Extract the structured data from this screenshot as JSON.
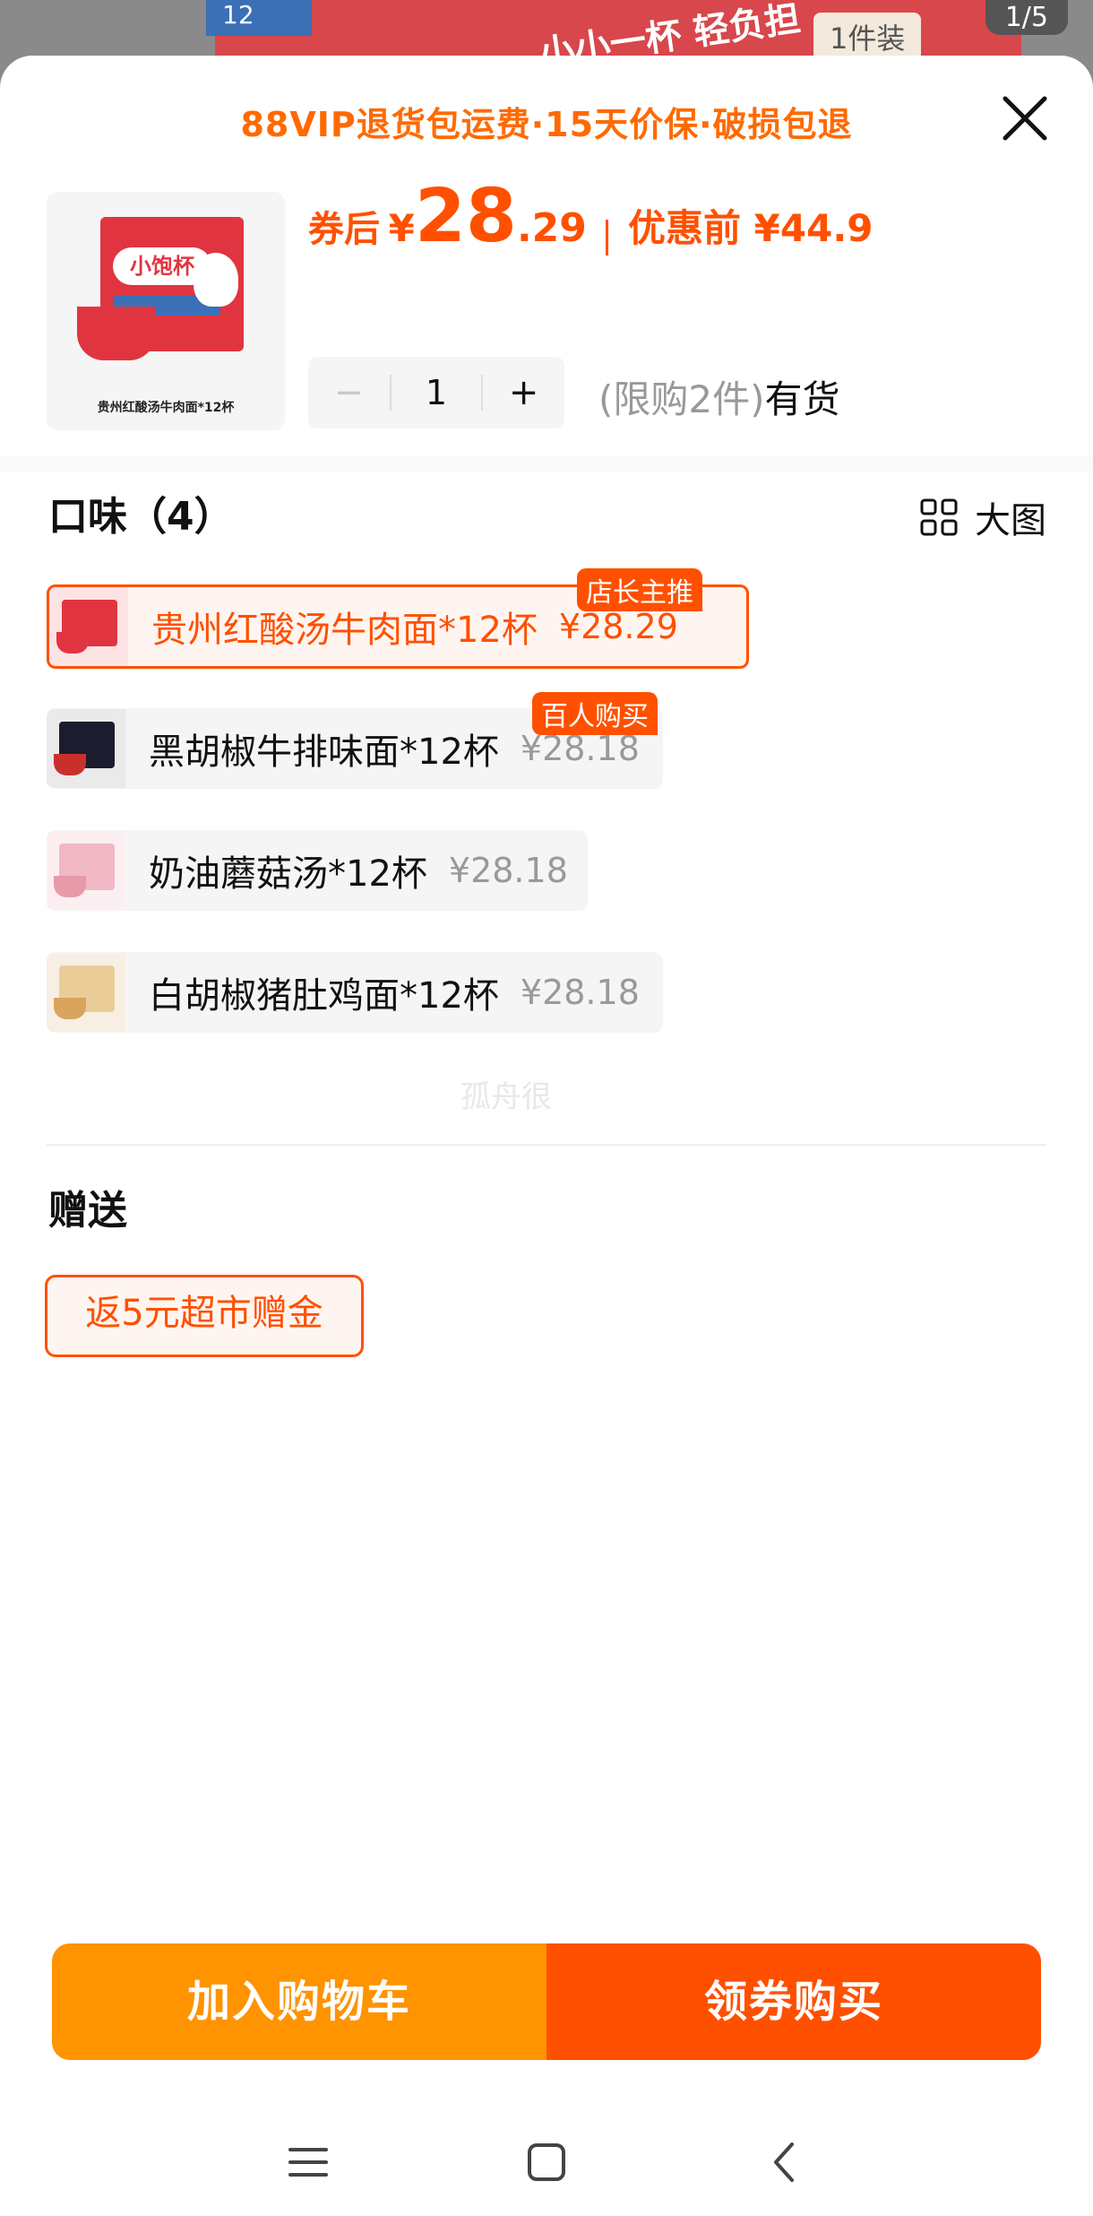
{
  "background": {
    "banner_slogan": "小小一杯 轻负担",
    "banner_badge": "1件装",
    "banner_mini": "12",
    "image_counter": "1/5"
  },
  "sheet": {
    "notice": "88VIP退货包运费·15天价保·破损包退",
    "product_thumb_caption": "贵州红酸汤牛肉面*12杯",
    "product_thumb_logo": "小饱杯",
    "price": {
      "after_label": "券后",
      "currency": "¥",
      "integer": "28",
      "decimal": ".29",
      "before_label": "优惠前 ¥44.9"
    },
    "quantity": {
      "minus": "−",
      "value": "1",
      "plus": "+"
    },
    "stock": {
      "limit": "(限购2件)",
      "status": "有货"
    },
    "flavor": {
      "title": "口味（4）",
      "big_view_label": "大图",
      "options": [
        {
          "name": "贵州红酸汤牛肉面*12杯",
          "price": "¥28.29",
          "tag": "店长主推",
          "selected": true
        },
        {
          "name": "黑胡椒牛排味面*12杯",
          "price": "¥28.18",
          "tag": "百人购买",
          "selected": false
        },
        {
          "name": "奶油蘑菇汤*12杯",
          "price": "¥28.18",
          "tag": "",
          "selected": false
        },
        {
          "name": "白胡椒猪肚鸡面*12杯",
          "price": "¥28.18",
          "tag": "",
          "selected": false
        }
      ]
    },
    "watermark": "孤舟很",
    "gift": {
      "title": "赠送",
      "chip": "返5元超市赠金"
    },
    "actions": {
      "add_to_cart": "加入购物车",
      "buy": "领券购买"
    }
  },
  "colors": {
    "accent": "#ff5000",
    "cart_button": "#ff9300",
    "muted": "#999999"
  },
  "icons": [
    "close-icon",
    "grid-icon",
    "menu-icon",
    "home-icon",
    "back-icon"
  ]
}
